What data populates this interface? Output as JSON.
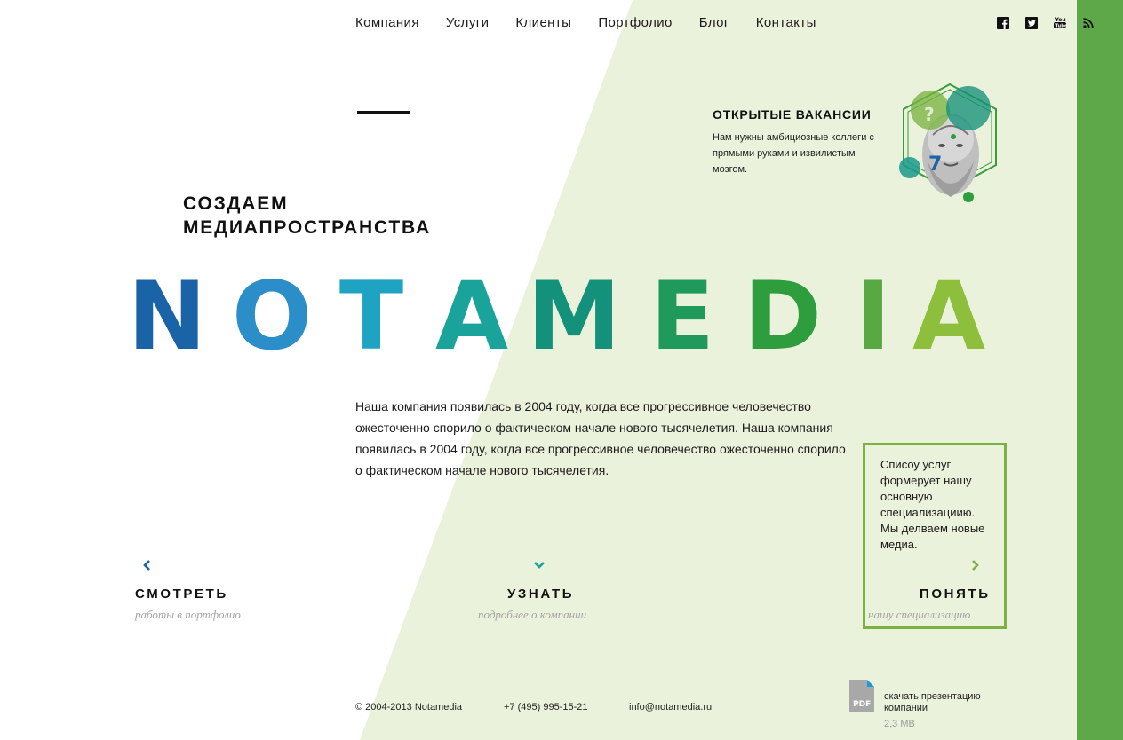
{
  "nav": {
    "items": [
      "Компания",
      "Услуги",
      "Клиенты",
      "Портфолио",
      "Блог",
      "Контакты"
    ]
  },
  "social": [
    "facebook-icon",
    "twitter-icon",
    "youtube-icon",
    "rss-icon"
  ],
  "vacancies": {
    "title": "ОТКРЫТЫЕ ВАКАНСИИ",
    "text": "Нам нужны амбициозные коллеги с прямыми руками и извилистым мозгом."
  },
  "tagline": {
    "line1": "СОЗДАЕМ",
    "line2": "МЕДИАПРОСТРАНСТВА"
  },
  "logo": {
    "letters": [
      "N",
      "O",
      "T",
      "A",
      "M",
      "E",
      "D",
      "I",
      "A"
    ],
    "colors": [
      "#1a63a6",
      "#2b8ec9",
      "#1ea3c2",
      "#1aa39a",
      "#14917a",
      "#1f9a5a",
      "#2d9d3e",
      "#58a844",
      "#8dbf3c"
    ]
  },
  "about": {
    "text": "Наша компания появилась в 2004 году, когда все прогрессивное человечество ожесточенно спорило о фактическом начале нового тысячелетия. Наша компания появилась в 2004 году, когда все прогрессивное человечество ожесточенно спорило о фактическом начале нового тысячелетия."
  },
  "services_box": {
    "text": "Списоу услуг формерует нашу основную специализациию. Мы делваем новые медиа."
  },
  "ctas": {
    "watch": {
      "title": "СМОТРЕТЬ",
      "sub": "работы в портфолио"
    },
    "learn": {
      "title": "УЗНАТЬ",
      "sub": "подробнее о компании"
    },
    "understand": {
      "title": "ПОНЯТЬ",
      "sub": "нашу специализацию"
    }
  },
  "footer": {
    "copyright": "© 2004-2013 Notamedia",
    "phone": "+7 (495) 995-15-21",
    "email": "info@notamedia.ru",
    "pdf_icon_text": "PDF",
    "download_label": "скачать презентацию компании",
    "download_size": "2,3 МВ"
  },
  "colors": {
    "accent_green": "#5fa84a",
    "pale_green": "#ebf2dc",
    "box_border": "#7ab342"
  }
}
